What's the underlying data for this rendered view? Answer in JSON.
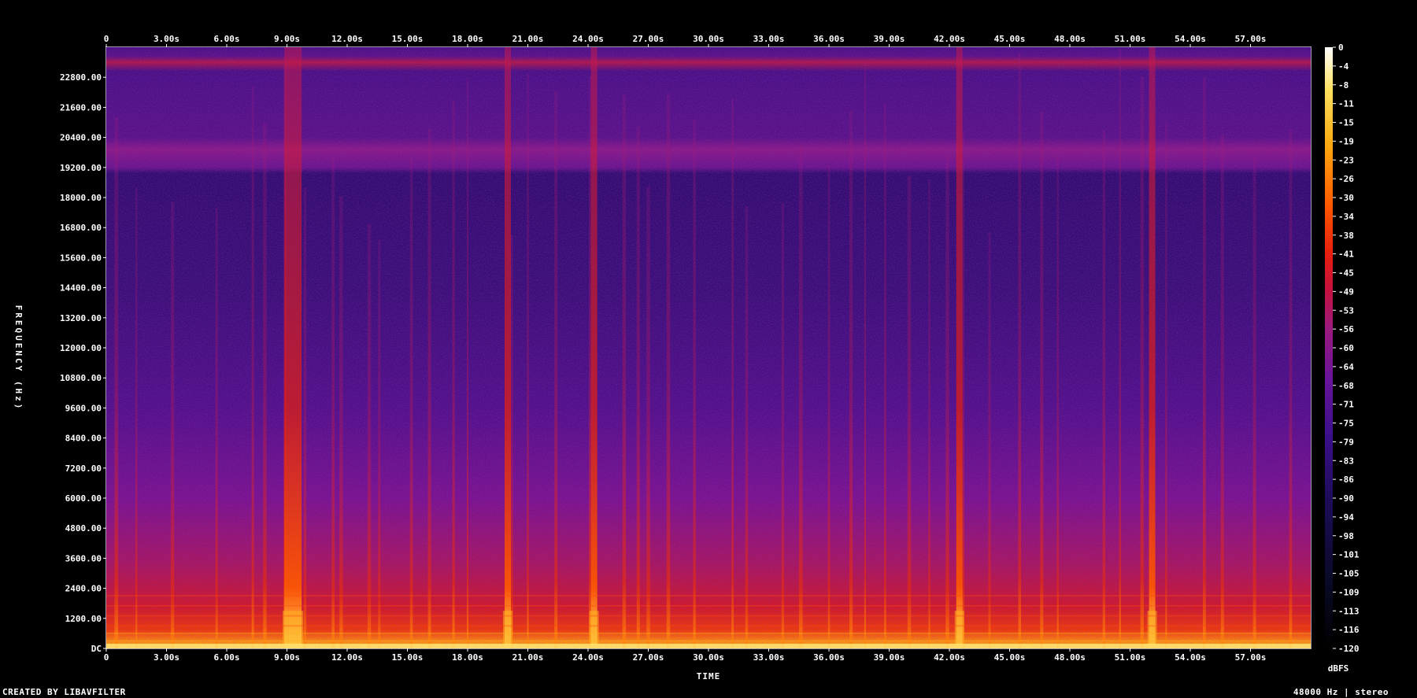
{
  "chart_data": {
    "type": "heatmap",
    "subtype": "spectrogram",
    "xlabel": "TIME",
    "ylabel": "FREQUENCY (Hz)",
    "colorbar_label": "dBFS",
    "x_range_seconds": [
      0,
      60
    ],
    "y_range_hz": [
      0,
      24000
    ],
    "colorbar_range_dbfs": [
      -120,
      0
    ],
    "x_ticks": [
      "0",
      "3.00s",
      "6.00s",
      "9.00s",
      "12.00s",
      "15.00s",
      "18.00s",
      "21.00s",
      "24.00s",
      "27.00s",
      "30.00s",
      "33.00s",
      "36.00s",
      "39.00s",
      "42.00s",
      "45.00s",
      "48.00s",
      "51.00s",
      "54.00s",
      "57.00s"
    ],
    "x_tick_values": [
      0,
      3,
      6,
      9,
      12,
      15,
      18,
      21,
      24,
      27,
      30,
      33,
      36,
      39,
      42,
      45,
      48,
      51,
      54,
      57
    ],
    "y_ticks": [
      "DC",
      "1200.00",
      "2400.00",
      "3600.00",
      "4800.00",
      "6000.00",
      "7200.00",
      "8400.00",
      "9600.00",
      "10800.00",
      "12000.00",
      "13200.00",
      "14400.00",
      "15600.00",
      "16800.00",
      "18000.00",
      "19200.00",
      "20400.00",
      "21600.00",
      "22800.00"
    ],
    "y_tick_values": [
      0,
      1200,
      2400,
      3600,
      4800,
      6000,
      7200,
      8400,
      9600,
      10800,
      12000,
      13200,
      14400,
      15600,
      16800,
      18000,
      19200,
      20400,
      21600,
      22800
    ],
    "colorbar_ticks": [
      "0",
      "-4",
      "-8",
      "-11",
      "-15",
      "-19",
      "-23",
      "-26",
      "-30",
      "-34",
      "-38",
      "-41",
      "-45",
      "-49",
      "-53",
      "-56",
      "-60",
      "-64",
      "-68",
      "-71",
      "-75",
      "-79",
      "-83",
      "-86",
      "-90",
      "-94",
      "-98",
      "-101",
      "-105",
      "-109",
      "-113",
      "-116",
      "-120"
    ],
    "colormap": [
      "#000000",
      "#0a0a2a",
      "#1e0c5a",
      "#3a0f8a",
      "#6a149a",
      "#9a1a80",
      "#c8103a",
      "#e8200c",
      "#ff5a00",
      "#ffaa10",
      "#ffe060",
      "#ffffff"
    ],
    "background_level_dbfs": -88,
    "high_band_cutoff_hz": 19400,
    "vertical_events_seconds": [
      0.5,
      1.5,
      3.3,
      5.5,
      7.3,
      7.9,
      8.9,
      9.9,
      11.3,
      11.7,
      13.1,
      13.6,
      15.2,
      16.1,
      17.3,
      18.0,
      20.2,
      21.0,
      22.4,
      24.1,
      25.8,
      26.5,
      27.0,
      28.0,
      29.3,
      31.2,
      31.9,
      33.7,
      34.6,
      36.0,
      37.1,
      37.8,
      38.8,
      40.0,
      41.0,
      41.9,
      42.7,
      44.0,
      45.5,
      46.6,
      47.4,
      49.7,
      50.5,
      51.6,
      52.8,
      54.7,
      55.6,
      57.2,
      59.0
    ],
    "strong_events_seconds": [
      9.3,
      20.0,
      24.3,
      42.5,
      52.1
    ]
  },
  "footer": {
    "left_text": "CREATED BY LIBAVFILTER",
    "right_text": "48000 Hz | stereo"
  }
}
